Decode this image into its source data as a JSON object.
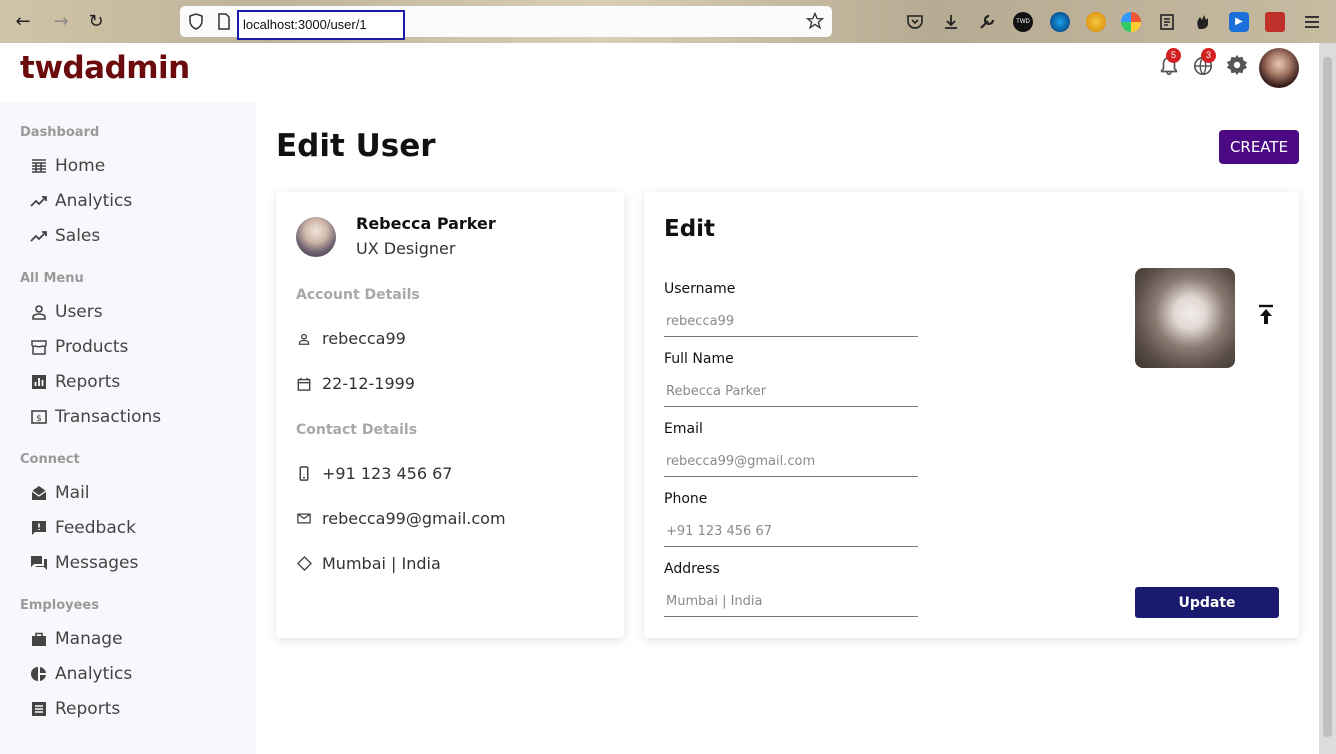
{
  "browser": {
    "url": "localhost:3000/user/1"
  },
  "app": {
    "logo": "twdadmin",
    "notifications_count": "5",
    "language_count": "3"
  },
  "sidebar": {
    "sections": [
      {
        "title": "Dashboard",
        "items": [
          {
            "label": "Home",
            "icon": "table-icon"
          },
          {
            "label": "Analytics",
            "icon": "trending-icon"
          },
          {
            "label": "Sales",
            "icon": "trending-icon"
          }
        ]
      },
      {
        "title": "All Menu",
        "items": [
          {
            "label": "Users",
            "icon": "person-icon"
          },
          {
            "label": "Products",
            "icon": "storefront-icon"
          },
          {
            "label": "Reports",
            "icon": "bar-chart-icon"
          },
          {
            "label": "Transactions",
            "icon": "money-icon"
          }
        ]
      },
      {
        "title": "Connect",
        "items": [
          {
            "label": "Mail",
            "icon": "mail-open-icon"
          },
          {
            "label": "Feedback",
            "icon": "feedback-icon"
          },
          {
            "label": "Messages",
            "icon": "chat-icon"
          }
        ]
      },
      {
        "title": "Employees",
        "items": [
          {
            "label": "Manage",
            "icon": "briefcase-icon"
          },
          {
            "label": "Analytics",
            "icon": "pie-chart-icon"
          },
          {
            "label": "Reports",
            "icon": "list-icon"
          }
        ]
      }
    ]
  },
  "page": {
    "title": "Edit User",
    "create_label": "CREATE"
  },
  "profile": {
    "name": "Rebecca Parker",
    "role": "UX Designer",
    "account_title": "Account Details",
    "username": "rebecca99",
    "birthday": "22-12-1999",
    "contact_title": "Contact Details",
    "phone": "+91 123 456 67",
    "email": "rebecca99@gmail.com",
    "address": "Mumbai | India"
  },
  "edit": {
    "title": "Edit",
    "fields": [
      {
        "label": "Username",
        "placeholder": "rebecca99"
      },
      {
        "label": "Full Name",
        "placeholder": "Rebecca Parker"
      },
      {
        "label": "Email",
        "placeholder": "rebecca99@gmail.com"
      },
      {
        "label": "Phone",
        "placeholder": "+91 123 456 67"
      },
      {
        "label": "Address",
        "placeholder": "Mumbai | India"
      }
    ],
    "update_label": "Update"
  },
  "colors": {
    "logo": "#6b0b0b",
    "create_button": "#4b0a84",
    "update_button": "#1a1a6e",
    "badge": "#d32020",
    "sidebar_bg": "#f7f7fc"
  }
}
